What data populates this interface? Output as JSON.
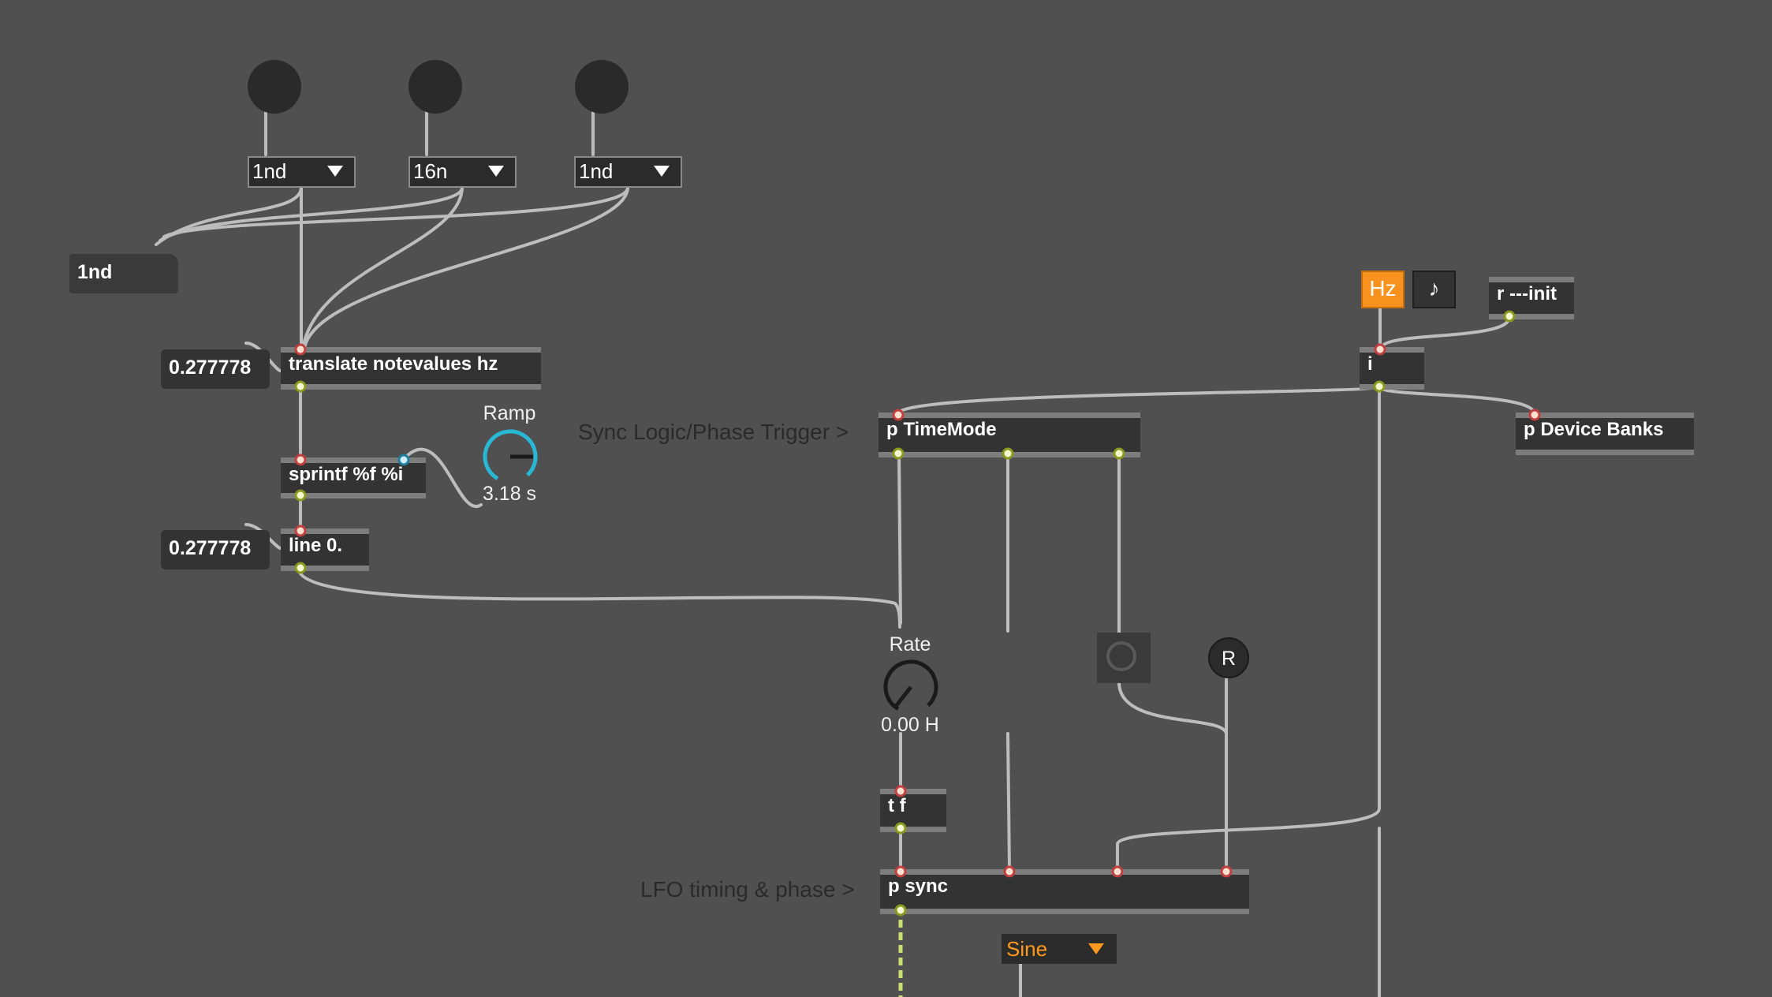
{
  "dials": [
    {
      "name": "dial-1"
    },
    {
      "name": "dial-2"
    },
    {
      "name": "dial-3"
    }
  ],
  "menus": {
    "notevalue_1": "1nd",
    "notevalue_2": "16n",
    "notevalue_3": "1nd",
    "waveform": "Sine"
  },
  "message_box": {
    "text": "1nd"
  },
  "numbers": {
    "translate_out": "0.277778",
    "line_out": "0.277778"
  },
  "objects": {
    "translate": "translate notevalues hz",
    "sprintf": "sprintf %f %i",
    "line": "line 0.",
    "timemode": "p TimeMode",
    "device_banks": "p Device Banks",
    "int": "i",
    "receive_init": "r ---init",
    "trigger": "t f",
    "sync": "p sync"
  },
  "knobs": {
    "ramp": {
      "label": "Ramp",
      "value": "3.18 s",
      "accent": "#2ab7d3"
    },
    "rate": {
      "label": "Rate",
      "value": "0.00 H"
    }
  },
  "comments": {
    "sync_logic": "Sync Logic/Phase Trigger >",
    "lfo_timing": "LFO timing & phase >"
  },
  "toggles": {
    "hz": {
      "label": "Hz",
      "active": true,
      "color": "#f7921e"
    },
    "note": {
      "label": "♪",
      "active": false
    }
  },
  "buttons": {
    "reset": "R"
  },
  "colors": {
    "background": "#505050",
    "object": "#333333",
    "patchcord": "#bdbdbd",
    "signal_cord": "#c8e070"
  }
}
